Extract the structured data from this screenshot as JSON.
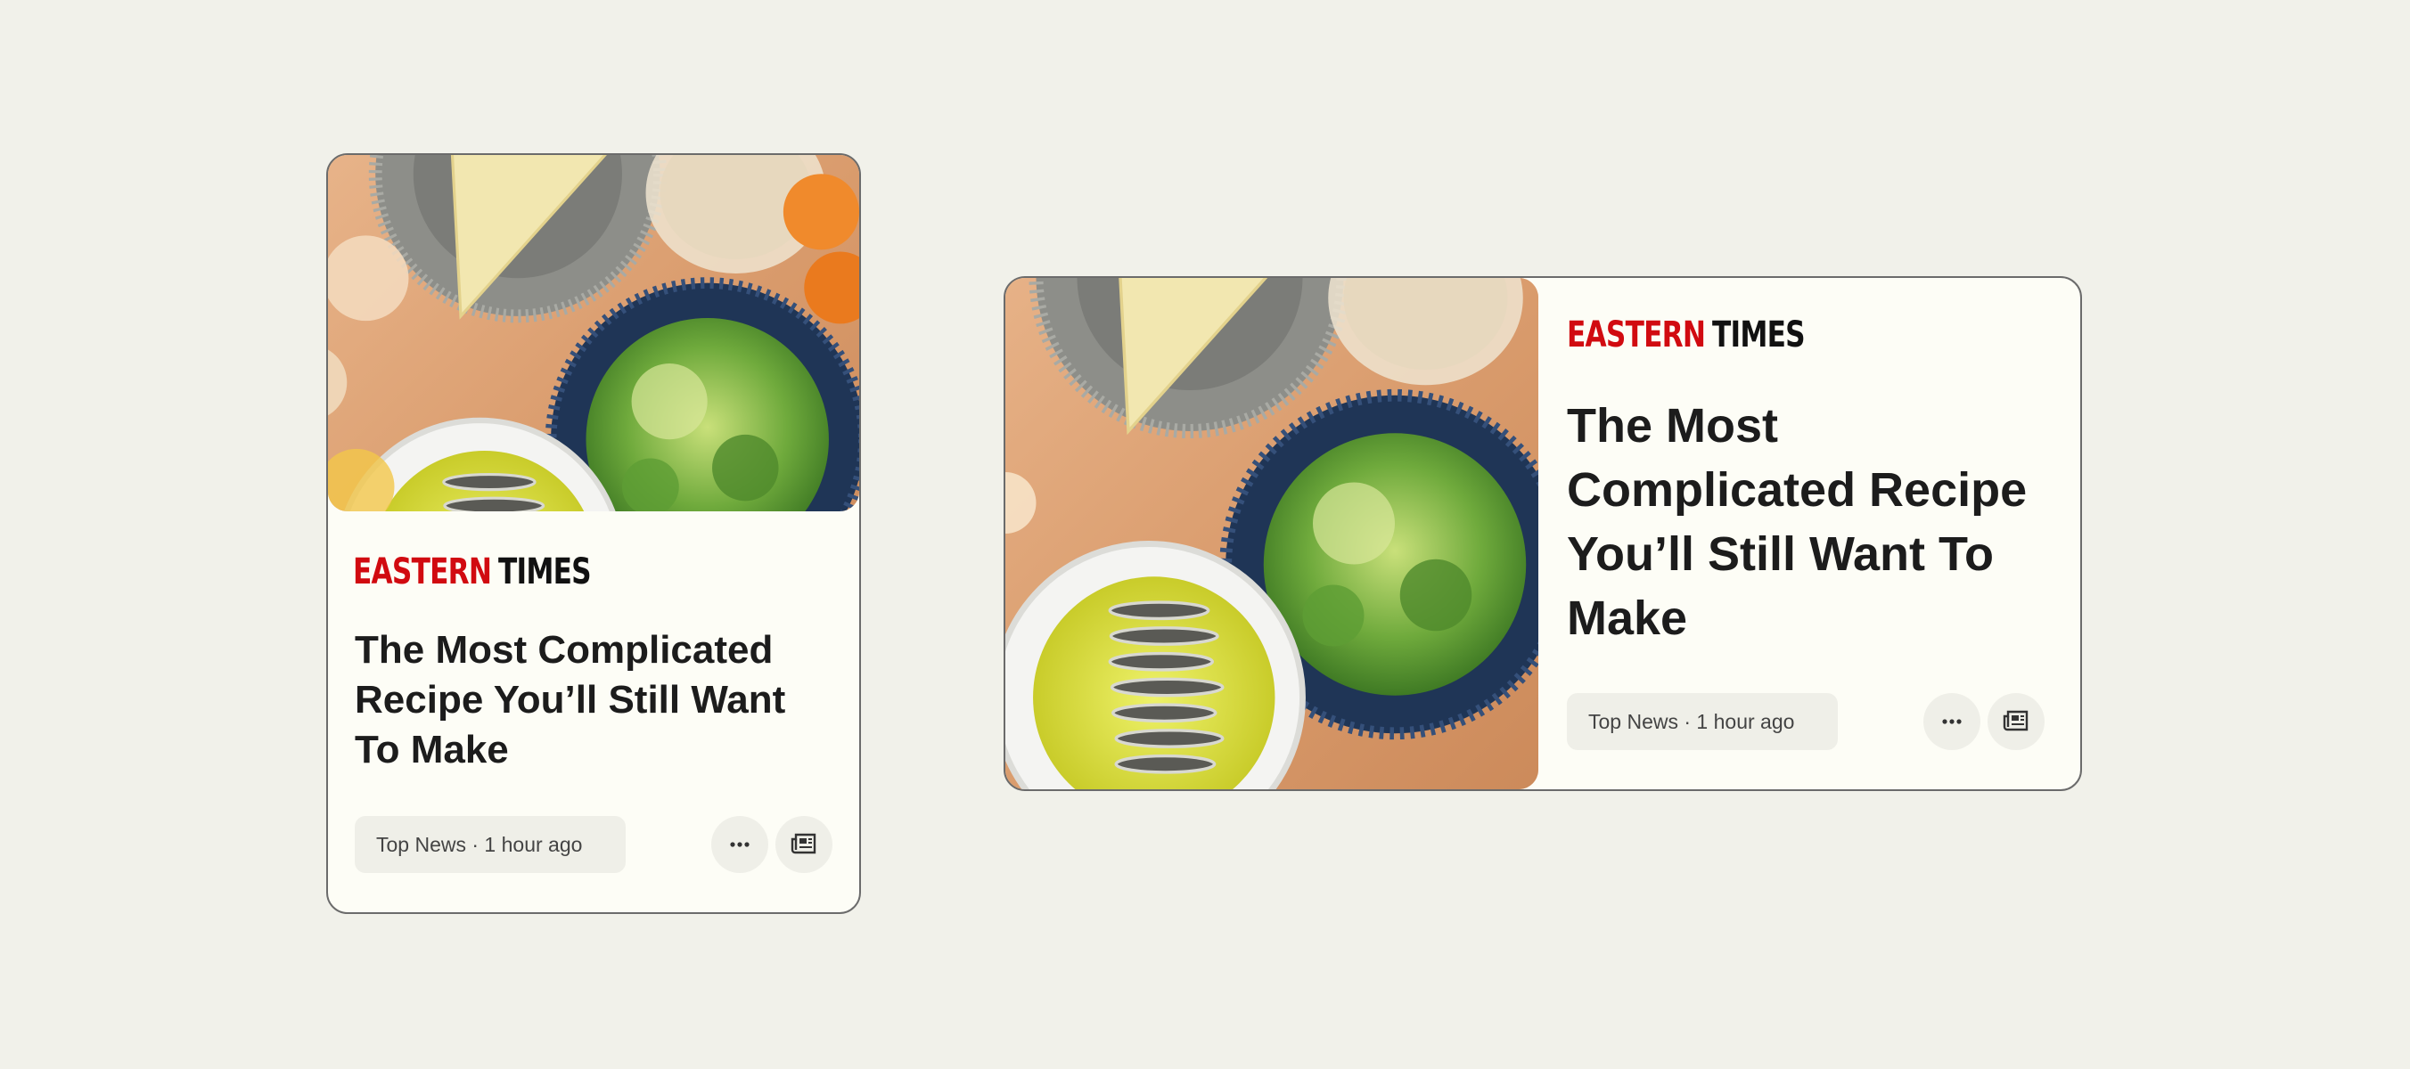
{
  "cards": [
    {
      "layout": "vertical",
      "brand": {
        "part1": "EASTERN",
        "part2": "TIMES",
        "part1_color": "#d10a10",
        "part2_color": "#111111"
      },
      "headline": "The Most Complicated Recipe You’ll Still Want To Make",
      "meta": "Top News · 1 hour ago",
      "image": "photo-food-table",
      "actions": [
        "more-icon",
        "newspaper-icon"
      ]
    },
    {
      "layout": "horizontal",
      "brand": {
        "part1": "EASTERN",
        "part2": "TIMES",
        "part1_color": "#d10a10",
        "part2_color": "#111111"
      },
      "headline": "The Most Complicated Recipe You’ll Still Want To Make",
      "meta": "Top News · 1 hour ago",
      "image": "photo-food-table",
      "actions": [
        "more-icon",
        "newspaper-icon"
      ]
    }
  ],
  "colors": {
    "background": "#f1f1ea",
    "card": "#fdfdf6",
    "chip": "#efefe8",
    "accent": "#d10a10"
  }
}
